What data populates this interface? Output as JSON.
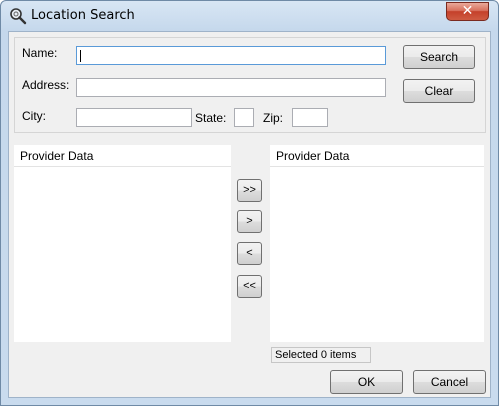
{
  "window": {
    "title": "Location Search",
    "close_glyph": "✕",
    "icon": "location-search-icon"
  },
  "search": {
    "name_label": "Name:",
    "name_value": "",
    "address_label": "Address:",
    "address_value": "",
    "city_label": "City:",
    "city_value": "",
    "state_label": "State:",
    "state_value": "",
    "zip_label": "Zip:",
    "zip_value": "",
    "search_button": "Search",
    "clear_button": "Clear"
  },
  "lists": {
    "left_header": "Provider Data",
    "right_header": "Provider Data",
    "left_items": [],
    "right_items": []
  },
  "transfer": {
    "add_all": ">>",
    "add_one": ">",
    "remove_one": "<",
    "remove_all": "<<"
  },
  "status": {
    "selected_text": "Selected 0 items"
  },
  "footer": {
    "ok_button": "OK",
    "cancel_button": "Cancel"
  },
  "colors": {
    "window_frame": "#c5d8ec",
    "client_background": "#f0f0f0",
    "close_button": "#c4402a",
    "focus_border": "#5a9ad8"
  }
}
